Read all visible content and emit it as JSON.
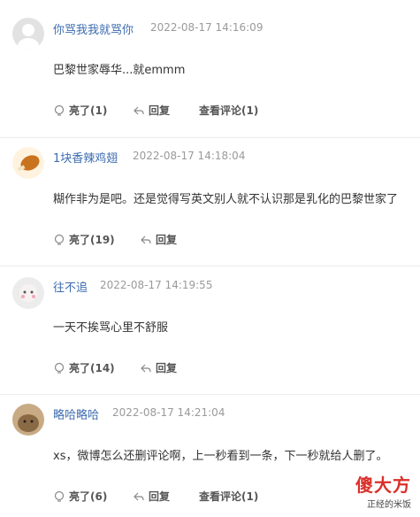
{
  "comments": [
    {
      "user": "你骂我我就骂你",
      "time": "2022-08-17 14:16:09",
      "text": "巴黎世家辱华...就emmm",
      "like": "亮了(1)",
      "reply": "回复",
      "view": "查看评论(1)"
    },
    {
      "user": "1块香辣鸡翅",
      "time": "2022-08-17 14:18:04",
      "text": "糊作非为是吧。还是觉得写英文别人就不认识那是乳化的巴黎世家了",
      "like": "亮了(19)",
      "reply": "回复",
      "view": ""
    },
    {
      "user": "往不追",
      "time": "2022-08-17 14:19:55",
      "text": "一天不挨骂心里不舒服",
      "like": "亮了(14)",
      "reply": "回复",
      "view": ""
    },
    {
      "user": "略哈略哈",
      "time": "2022-08-17 14:21:04",
      "text": "xs，微博怎么还删评论啊，上一秒看到一条，下一秒就给人删了。",
      "like": "亮了(6)",
      "reply": "回复",
      "view": "查看评论(1)"
    }
  ],
  "watermark": {
    "big": "傻大方",
    "small": "正经的米饭"
  },
  "colors": {
    "username": "#3d6cb0",
    "timestamp": "#9a9a9a",
    "divider": "#ececec",
    "watermark_red": "#d9302a"
  }
}
